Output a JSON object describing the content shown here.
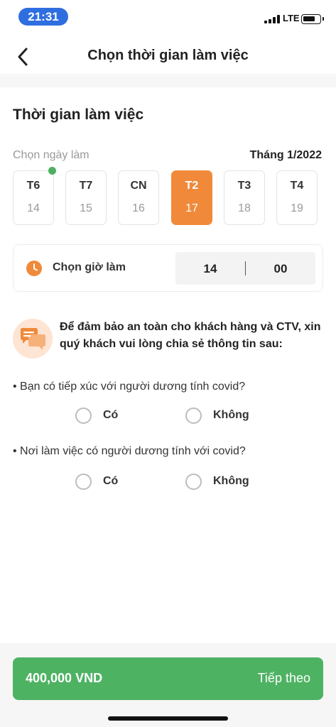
{
  "status_bar": {
    "time": "21:31",
    "network": "LTE"
  },
  "header": {
    "title": "Chọn thời gian làm việc"
  },
  "section_title": "Thời gian làm việc",
  "date_picker": {
    "label": "Chọn ngày làm",
    "month": "Tháng 1/2022",
    "days": [
      {
        "dow": "T6",
        "date": "14",
        "selected": false,
        "has_dot": true
      },
      {
        "dow": "T7",
        "date": "15",
        "selected": false
      },
      {
        "dow": "CN",
        "date": "16",
        "selected": false
      },
      {
        "dow": "T2",
        "date": "17",
        "selected": true
      },
      {
        "dow": "T3",
        "date": "18",
        "selected": false
      },
      {
        "dow": "T4",
        "date": "19",
        "selected": false
      }
    ]
  },
  "time_picker": {
    "label": "Chọn giờ làm",
    "hour": "14",
    "minute": "00"
  },
  "notice": {
    "text": "Để đảm bảo an toàn cho khách hàng và CTV, xin quý khách vui lòng chia sẻ thông tin sau:"
  },
  "questions": [
    {
      "text": "• Bạn có tiếp xúc với người dương tính covid?",
      "yes": "Có",
      "no": "Không"
    },
    {
      "text": "• Nơi làm việc có người dương tính với covid?",
      "yes": "Có",
      "no": "Không"
    }
  ],
  "footer": {
    "price": "400,000 VND",
    "next_label": "Tiếp theo"
  },
  "colors": {
    "accent_orange": "#f08a3a",
    "cta_green": "#4eb263",
    "dot_green": "#4caf62",
    "status_pill": "#2f6ee0"
  },
  "icons": [
    "back-chevron-icon",
    "clock-icon",
    "chat-bubbles-icon",
    "signal-icon",
    "battery-icon"
  ]
}
